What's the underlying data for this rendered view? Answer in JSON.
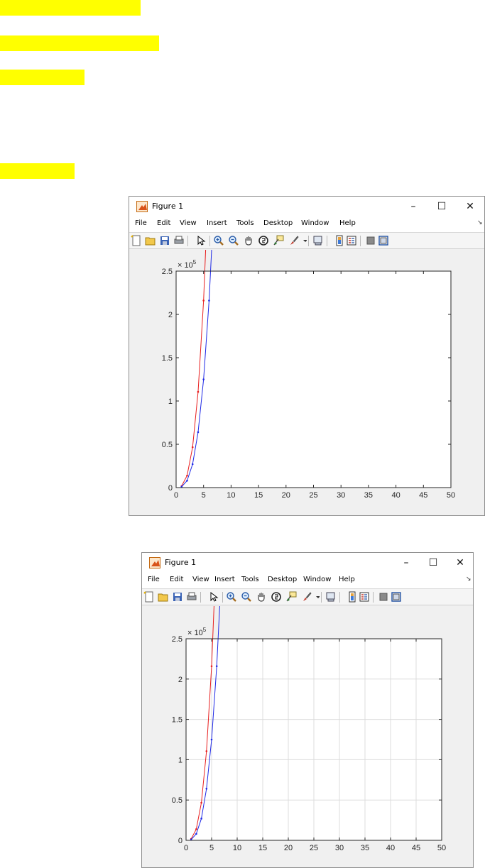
{
  "window": {
    "title": "Figure 1",
    "minimize_glyph": "–",
    "maximize_glyph": "☐",
    "close_glyph": "✕"
  },
  "menu": {
    "items": [
      "File",
      "Edit",
      "View",
      "Insert",
      "Tools",
      "Desktop",
      "Window",
      "Help"
    ],
    "overflow_glyph": "↘"
  },
  "toolbar": {
    "icons": [
      "new-figure-icon",
      "open-file-icon",
      "save-icon",
      "print-icon",
      "edit-plot-arrow-icon",
      "zoom-in-icon",
      "zoom-out-icon",
      "pan-hand-icon",
      "rotate-3d-icon",
      "data-cursor-icon",
      "brush-icon",
      "brush-dropdown-icon",
      "link-plot-icon",
      "insert-colorbar-icon",
      "insert-legend-icon",
      "hide-plot-tools-icon",
      "show-plot-tools-icon"
    ]
  },
  "colors": {
    "series_red": "#e81e1e",
    "series_blue": "#1e28e6",
    "highlight": "#ffff00",
    "grid": "#dcdcdc"
  },
  "chart_data": [
    {
      "type": "line",
      "grid": false,
      "exponent_label": "× 10^5",
      "xlim": [
        0,
        50
      ],
      "ylim": [
        0,
        250000
      ],
      "xticks": [
        0,
        5,
        10,
        15,
        20,
        25,
        30,
        35,
        40,
        45,
        50
      ],
      "yticks": [
        0,
        0.5,
        1,
        1.5,
        2,
        2.5
      ],
      "series": [
        {
          "color": "#e81e1e",
          "marker": ".",
          "x": "1..50 step 1",
          "formula": "y ≈ 1728·x^3 (approx. 216000 at x=50)"
        },
        {
          "color": "#1e28e6",
          "marker": ".",
          "x": "1..50 step 1",
          "formula": "y ≈ 1000·x^3 (approx. 125000 at x=50)"
        }
      ]
    },
    {
      "type": "line",
      "grid": true,
      "exponent_label": "× 10^5",
      "xlim": [
        0,
        50
      ],
      "ylim": [
        0,
        250000
      ],
      "xticks": [
        0,
        5,
        10,
        15,
        20,
        25,
        30,
        35,
        40,
        45,
        50
      ],
      "yticks": [
        0,
        0.5,
        1,
        1.5,
        2,
        2.5
      ],
      "series": [
        {
          "color": "#e81e1e",
          "marker": ".",
          "x": "1..50 step 1",
          "formula": "y ≈ 1728·x^3 (approx. 216000 at x=50)"
        },
        {
          "color": "#1e28e6",
          "marker": ".",
          "x": "1..50 step 1",
          "formula": "y ≈ 1000·x^3 (approx. 125000 at x=50)"
        }
      ]
    }
  ]
}
